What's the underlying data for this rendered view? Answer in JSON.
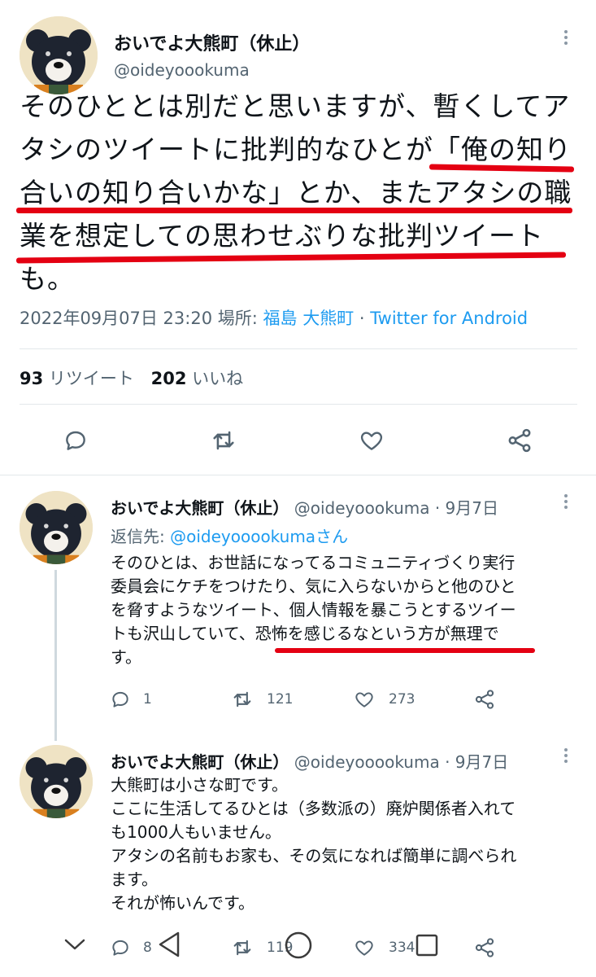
{
  "main_tweet": {
    "display_name": "おいでよ大熊町（休止）",
    "handle": "@oideyoookuma",
    "text_lines": [
      "そのひととは別だと思いますが、暫くしてア",
      "タシのツイートに批判的なひとが「俺の知り",
      "合いの知り合いかな」とか、またアタシの職",
      "業を想定しての思わせぶりな批判ツイート",
      "も。"
    ],
    "timestamp": "2022年09月07日 23:20",
    "location_label": "場所:",
    "location": "福島 大熊町",
    "separator": "·",
    "source": "Twitter for Android",
    "retweets_count": "93",
    "retweets_label": "リツイート",
    "likes_count": "202",
    "likes_label": "いいね"
  },
  "replies": [
    {
      "display_name": "おいでよ大熊町（休止）",
      "meta": "@oideyoookuma · 9月7日",
      "reply_to_label": "返信先:",
      "reply_to_handle": "@oideyooookumaさん",
      "text_lines": [
        "そのひとは、お世話になってるコミュニティづくり実行",
        "委員会にケチをつけたり、気に入らないからと他のひと",
        "を脅すようなツイート、個人情報を暴こうとするツイー",
        "トも沢山していて、恐怖を感じるなという方が無理で",
        "す。"
      ],
      "replies": "1",
      "retweets": "121",
      "likes": "273"
    },
    {
      "display_name": "おいでよ大熊町（休止）",
      "meta": "@oideyooookuma · 9月7日",
      "text_lines": [
        "大熊町は小さな町です。",
        "ここに生活してるひとは（多数派の）廃炉関係者入れて",
        "も1000人もいません。",
        "アタシの名前もお家も、その気になれば簡単に調べられ",
        "ます。",
        "それが怖いんです。"
      ],
      "replies": "8",
      "retweets": "119",
      "likes": "334"
    }
  ],
  "icons": {
    "reply": "reply-icon",
    "retweet": "retweet-icon",
    "like": "heart-icon",
    "share": "share-icon",
    "more": "more-vertical-icon",
    "nav_down": "chevron-down-icon",
    "nav_back": "back-triangle-icon",
    "nav_home": "home-circle-icon",
    "nav_recents": "recents-square-icon"
  },
  "colors": {
    "accent": "#1d9bf0",
    "highlight_underline": "#e40012",
    "secondary_text": "#536471"
  }
}
